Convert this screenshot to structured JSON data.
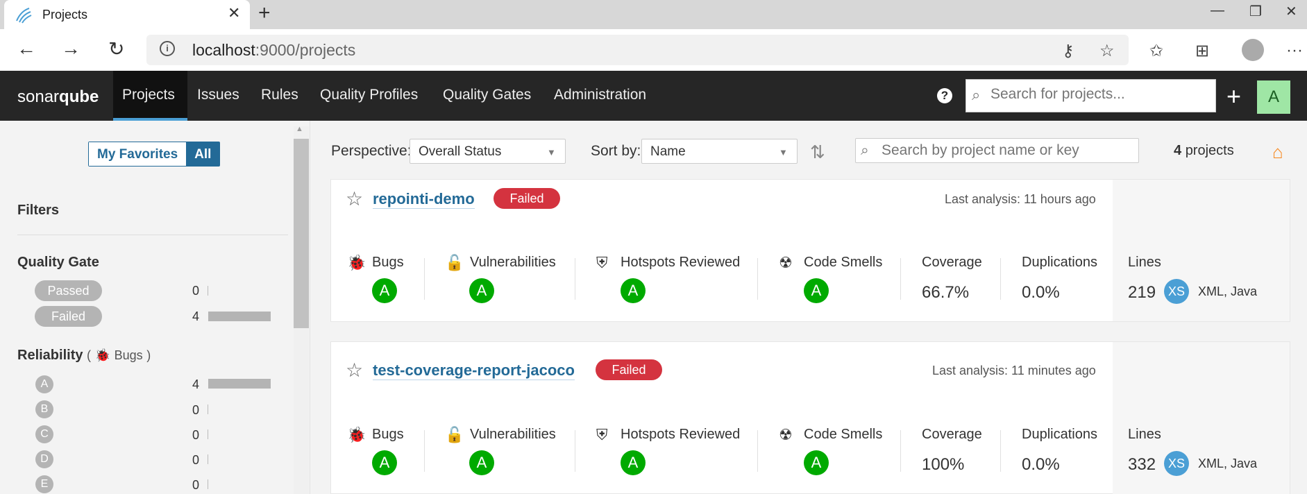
{
  "browser": {
    "tab_title": "Projects",
    "tab_close": "✕",
    "new_tab": "+",
    "url_host": "localhost",
    "url_rest": ":9000/projects",
    "window_controls": [
      "—",
      "❐",
      "✕"
    ],
    "more": "···"
  },
  "nav": {
    "logo_part1": "sonar",
    "logo_part2": "qube",
    "items": [
      "Projects",
      "Issues",
      "Rules",
      "Quality Profiles",
      "Quality Gates",
      "Administration"
    ],
    "active": "Projects",
    "help": "?",
    "search_placeholder": "Search for projects...",
    "plus": "+",
    "avatar_letter": "A"
  },
  "sidebar": {
    "toggle": {
      "favorites": "My Favorites",
      "all": "All",
      "selected": "All"
    },
    "filters_title": "Filters",
    "quality_gate": {
      "title": "Quality Gate",
      "options": [
        {
          "label": "Passed",
          "count": "0",
          "fraction": 0
        },
        {
          "label": "Failed",
          "count": "4",
          "fraction": 1
        }
      ]
    },
    "reliability": {
      "title": "Reliability",
      "open_paren": "(",
      "sub": "Bugs",
      "close_paren": ")",
      "options": [
        {
          "label": "A",
          "count": "4",
          "fraction": 1
        },
        {
          "label": "B",
          "count": "0",
          "fraction": 0
        },
        {
          "label": "C",
          "count": "0",
          "fraction": 0
        },
        {
          "label": "D",
          "count": "0",
          "fraction": 0
        },
        {
          "label": "E",
          "count": "0",
          "fraction": 0
        }
      ]
    }
  },
  "header": {
    "perspective_label": "Perspective:",
    "perspective_value": "Overall Status",
    "sort_label": "Sort by:",
    "sort_value": "Name",
    "search_placeholder": "Search by project name or key",
    "count_number": "4",
    "count_suffix": "projects"
  },
  "metric_labels": {
    "bugs": "Bugs",
    "vulnerabilities": "Vulnerabilities",
    "hotspots": "Hotspots Reviewed",
    "smells": "Code Smells",
    "coverage": "Coverage",
    "duplications": "Duplications",
    "lines": "Lines"
  },
  "projects": [
    {
      "name": "repointi-demo",
      "status": "Failed",
      "last_analysis": "Last analysis: 11 hours ago",
      "bugs": "A",
      "vulnerabilities": "A",
      "hotspots": "A",
      "smells": "A",
      "coverage": "66.7%",
      "duplications": "0.0%",
      "lines": "219",
      "size": "XS",
      "languages": "XML, Java"
    },
    {
      "name": "test-coverage-report-jacoco",
      "status": "Failed",
      "last_analysis": "Last analysis: 11 minutes ago",
      "bugs": "A",
      "vulnerabilities": "A",
      "hotspots": "A",
      "smells": "A",
      "coverage": "100%",
      "duplications": "0.0%",
      "lines": "332",
      "size": "XS",
      "languages": "XML, Java"
    }
  ],
  "colors": {
    "nav_bg": "#262626",
    "link_blue": "#236a97",
    "failed_red": "#d4333f",
    "grade_green": "#00aa00",
    "size_blue": "#4b9fd5",
    "home_orange": "#f7861b"
  }
}
